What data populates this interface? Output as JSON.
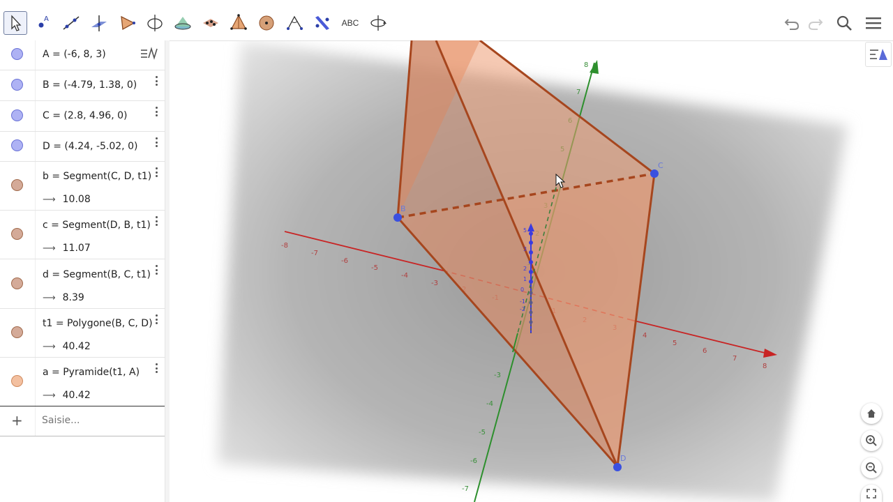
{
  "toolbar": {
    "tools": [
      {
        "name": "move-tool",
        "icon": "cursor-icon"
      },
      {
        "name": "point-tool",
        "icon": "point-icon"
      },
      {
        "name": "line-tool",
        "icon": "line-icon"
      },
      {
        "name": "perpendicular-line-tool",
        "icon": "perpendicular-icon"
      },
      {
        "name": "polygon-tool",
        "icon": "triangle-icon"
      },
      {
        "name": "circle-axis-tool",
        "icon": "circle-axis-icon"
      },
      {
        "name": "plane-tool",
        "icon": "plane-icon"
      },
      {
        "name": "pyramid-tool",
        "icon": "pyramid-icon"
      },
      {
        "name": "net-tool",
        "icon": "net-icon"
      },
      {
        "name": "sphere-tool",
        "icon": "sphere-icon"
      },
      {
        "name": "angle-tool",
        "icon": "angle-icon"
      },
      {
        "name": "reflect-tool",
        "icon": "reflect-icon"
      },
      {
        "name": "text-tool",
        "label": "ABC"
      },
      {
        "name": "rotate-view-tool",
        "icon": "rotate-view-icon"
      }
    ],
    "undo": "undo-icon",
    "redo": "redo-icon",
    "search": "search-icon",
    "menu": "menu-icon"
  },
  "algebra": {
    "rows": [
      {
        "expr": "A = (-6, 8, 3)",
        "color": "#aeb2f4",
        "border": "#5a62d6"
      },
      {
        "expr": "B = (-4.79, 1.38, 0)",
        "color": "#aeb2f4",
        "border": "#5a62d6"
      },
      {
        "expr": "C = (2.8, 4.96, 0)",
        "color": "#aeb2f4",
        "border": "#5a62d6"
      },
      {
        "expr": "D = (4.24, -5.02, 0)",
        "color": "#aeb2f4",
        "border": "#5a62d6"
      },
      {
        "expr": "b = Segment(C, D, t1)",
        "value": "10.08",
        "color": "#d4aa98",
        "border": "#a06040"
      },
      {
        "expr": "c = Segment(D, B, t1)",
        "value": "11.07",
        "color": "#d4aa98",
        "border": "#a06040"
      },
      {
        "expr": "d = Segment(B, C, t1)",
        "value": "8.39",
        "color": "#d4aa98",
        "border": "#a06040"
      },
      {
        "expr": "t1 = Polygone(B, C, D)",
        "value": "40.42",
        "color": "#d4aa98",
        "border": "#a06040"
      },
      {
        "expr": "a = Pyramide(t1, A)",
        "value": "40.42",
        "color": "#f3c0a0",
        "border": "#d08050"
      }
    ],
    "input_placeholder": "Saisie...",
    "value_arrow": "⟶"
  },
  "view3d": {
    "x_ticks": [
      "-8",
      "-7",
      "-6",
      "-5",
      "-4",
      "-3",
      "2",
      "-1",
      "1",
      "2",
      "3",
      "4",
      "5",
      "6",
      "7",
      "8"
    ],
    "y_ticks": [
      "8",
      "7",
      "6",
      "5",
      "4",
      "3",
      "2",
      "1",
      "0",
      "-1",
      "-2"
    ],
    "z_ticks": [
      "8",
      "7",
      "6",
      "5",
      "3",
      "2",
      "1",
      "-3",
      "-4",
      "-5",
      "-6",
      "-7"
    ],
    "point_labels": [
      "B",
      "C",
      "D"
    ],
    "colors": {
      "pyramid": "#e8946a",
      "edge": "#a6461e",
      "x_axis": "#c82424",
      "y_axis": "#2d8f2d",
      "z_axis": "#3a3ae0",
      "point": "#3a50e0"
    }
  },
  "side_buttons": [
    "home-icon",
    "zoom-in-icon",
    "zoom-out-icon",
    "fullscreen-icon"
  ]
}
